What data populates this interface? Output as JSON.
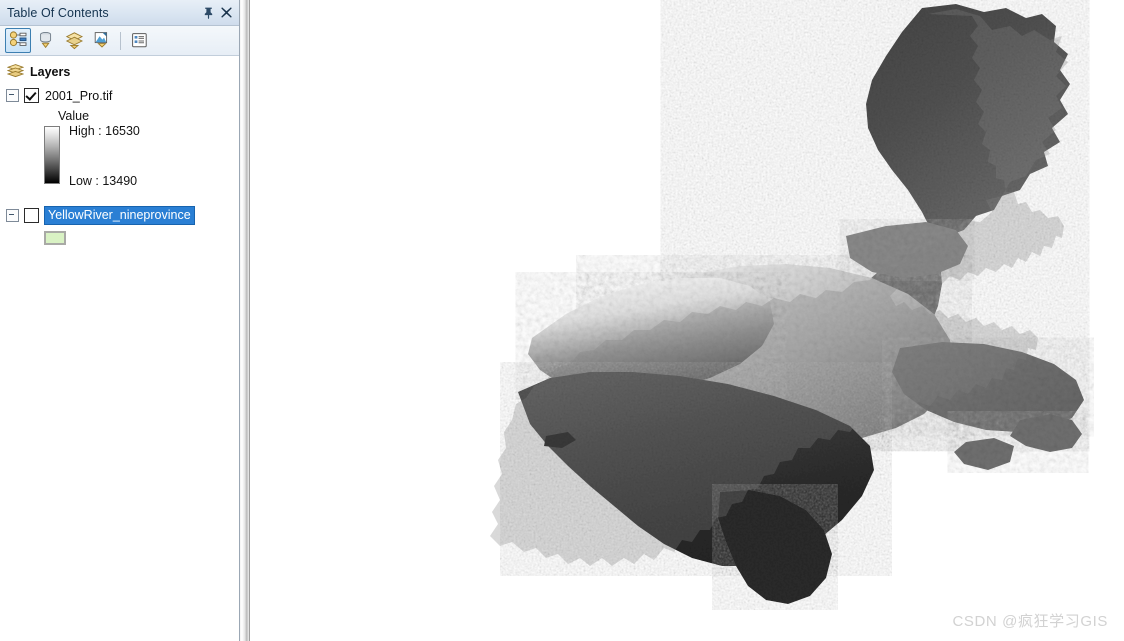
{
  "panel": {
    "title": "Table Of Contents",
    "pin_icon": "pin-icon",
    "close_icon": "close-icon",
    "toolbar": [
      {
        "name": "list-by-drawing-order-button",
        "icon": "drawing-order-icon",
        "active": true
      },
      {
        "name": "list-by-source-button",
        "icon": "source-icon",
        "active": false
      },
      {
        "name": "list-by-visibility-button",
        "icon": "visibility-icon",
        "active": false
      },
      {
        "name": "list-by-selection-button",
        "icon": "selection-icon",
        "active": false
      },
      {
        "name": "options-button",
        "icon": "options-list-icon",
        "active": false
      }
    ]
  },
  "tree": {
    "root_label": "Layers",
    "raster_layer": {
      "name": "2001_Pro.tif",
      "checked": true,
      "expanded": true,
      "legend": {
        "field_label": "Value",
        "high_label": "High : 16530",
        "low_label": "Low : 13490",
        "high_value": 16530,
        "low_value": 13490,
        "ramp_top_color": "#ffffff",
        "ramp_bottom_color": "#000000"
      }
    },
    "vector_layer": {
      "name": "YellowRiver_nineprovince",
      "checked": false,
      "expanded": true,
      "selected": true,
      "selection_color": "#2a7fd4",
      "symbol_fill": "#d9f2c4",
      "symbol_outline": "#a9aaa6"
    }
  },
  "map": {
    "watermark": "CSDN @疯狂学习GIS",
    "background": "#ffffff"
  }
}
